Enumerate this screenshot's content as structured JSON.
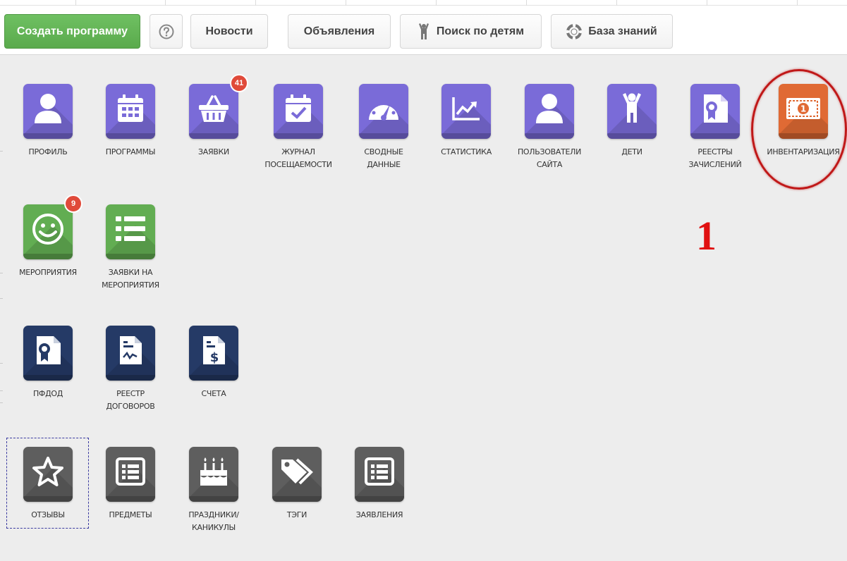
{
  "toolbar": {
    "create_program": "Создать программу",
    "news": "Новости",
    "announcements": "Объявления",
    "child_search": "Поиск по детям",
    "knowledge_base": "База знаний"
  },
  "tiles": {
    "profile": "ПРОФИЛЬ",
    "programs": "ПРОГРАММЫ",
    "applications": "ЗАЯВКИ",
    "applications_badge": "41",
    "attendance_1": "ЖУРНАЛ",
    "attendance_2": "ПОСЕЩАЕМОСТИ",
    "summary_1": "СВОДНЫЕ",
    "summary_2": "ДАННЫЕ",
    "statistics": "СТАТИСТИКА",
    "site_users_1": "ПОЛЬЗОВАТЕЛИ",
    "site_users_2": "САЙТА",
    "children": "ДЕТИ",
    "enrollment_1": "РЕЕСТРЫ",
    "enrollment_2": "ЗАЧИСЛЕНИЙ",
    "inventory": "ИНВЕНТАРИЗАЦИЯ",
    "events": "МЕРОПРИЯТИЯ",
    "events_badge": "9",
    "event_apps_1": "ЗАЯВКИ НА",
    "event_apps_2": "МЕРОПРИЯТИЯ",
    "pfdod": "ПФДОД",
    "contracts_1": "РЕЕСТР",
    "contracts_2": "ДОГОВОРОВ",
    "invoices": "СЧЕТА",
    "reviews": "ОТЗЫВЫ",
    "subjects": "ПРЕДМЕТЫ",
    "holidays_1": "ПРАЗДНИКИ/",
    "holidays_2": "КАНИКУЛЫ",
    "tags": "ТЭГИ",
    "statements": "ЗАЯВЛЕНИЯ"
  },
  "annotation": "1",
  "icons": {
    "help": "question-circle-icon",
    "child_search": "child-icon",
    "knowledge_base": "lifebuoy-icon"
  },
  "colors": {
    "primary_green": "#5aaa4c",
    "tile_purple": "#7a6bd8",
    "tile_green": "#62ad52",
    "tile_navy": "#253a66",
    "tile_gray": "#5e5e5e",
    "tile_orange": "#e06a34",
    "badge_red": "#e04a3a",
    "annotation_red": "#e01010"
  }
}
